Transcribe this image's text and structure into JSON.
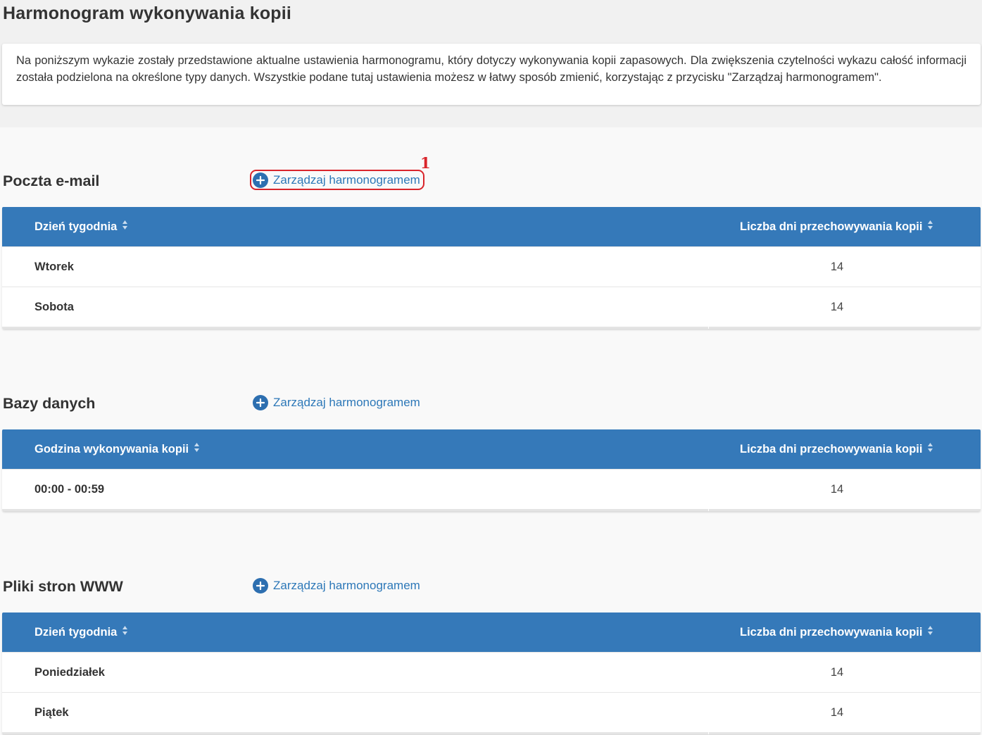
{
  "page": {
    "title": "Harmonogram wykonywania kopii",
    "description": "Na poniższym wykazie zostały przedstawione aktualne ustawienia harmonogramu, który dotyczy wykonywania kopii zapasowych. Dla zwiększenia czytelności wykazu całość informacji została podzielona na określone typy danych. Wszystkie podane tutaj ustawienia możesz w łatwy sposób zmienić, korzystając z przycisku \"Zarządzaj harmonogramem\"."
  },
  "annotation": {
    "number": "1",
    "color": "#d9252b"
  },
  "colors": {
    "accent": "#3579b9",
    "link": "#2d78b8"
  },
  "sections": [
    {
      "title": "Poczta e-mail",
      "manage_label": "Zarządzaj harmonogramem",
      "columns": [
        "Dzień tygodnia",
        "Liczba dni przechowywania kopii"
      ],
      "rows": [
        [
          "Wtorek",
          "14"
        ],
        [
          "Sobota",
          "14"
        ]
      ]
    },
    {
      "title": "Bazy danych",
      "manage_label": "Zarządzaj harmonogramem",
      "columns": [
        "Godzina wykonywania kopii",
        "Liczba dni przechowywania kopii"
      ],
      "rows": [
        [
          "00:00 - 00:59",
          "14"
        ]
      ]
    },
    {
      "title": "Pliki stron WWW",
      "manage_label": "Zarządzaj harmonogramem",
      "columns": [
        "Dzień tygodnia",
        "Liczba dni przechowywania kopii"
      ],
      "rows": [
        [
          "Poniedziałek",
          "14"
        ],
        [
          "Piątek",
          "14"
        ]
      ]
    }
  ]
}
